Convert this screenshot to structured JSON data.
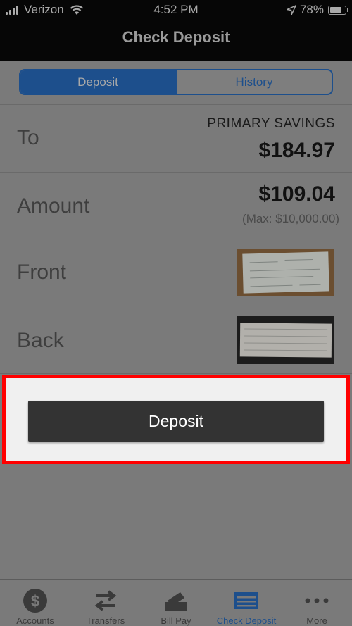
{
  "status_bar": {
    "carrier": "Verizon",
    "time": "4:52 PM",
    "battery": "78%",
    "battery_level": 0.78
  },
  "nav": {
    "title": "Check Deposit"
  },
  "segments": {
    "deposit": "Deposit",
    "history": "History"
  },
  "form": {
    "to_label": "To",
    "account_name": "PRIMARY SAVINGS",
    "account_balance": "$184.97",
    "amount_label": "Amount",
    "amount_value": "$109.04",
    "amount_max": "(Max: $10,000.00)",
    "front_label": "Front",
    "back_label": "Back"
  },
  "deposit_button": "Deposit",
  "tabbar": {
    "accounts": "Accounts",
    "transfers": "Transfers",
    "bill_pay": "Bill Pay",
    "check_deposit": "Check Deposit",
    "more": "More"
  },
  "colors": {
    "accent": "#1d4f8c",
    "highlight": "#ff0000",
    "button": "#333333"
  }
}
